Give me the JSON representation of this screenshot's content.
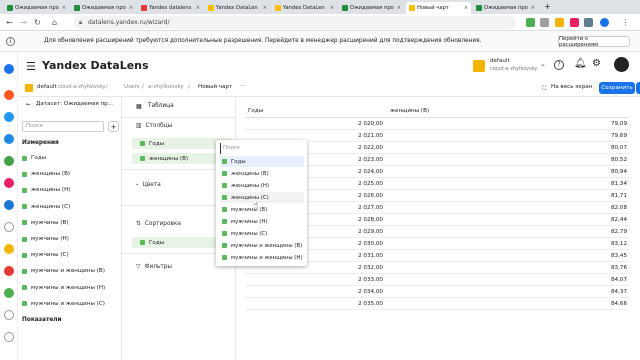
{
  "browser": {
    "tabs": [
      {
        "label": "Ожидаемая про",
        "color": "#1e8e3e"
      },
      {
        "label": "Ожидаемая про",
        "color": "#1e8e3e"
      },
      {
        "label": "Yandex datalens",
        "color": "#e53935"
      },
      {
        "label": "Yandex DataLen",
        "color": "#fbbc04"
      },
      {
        "label": "Yandex DataLen",
        "color": "#fbbc04"
      },
      {
        "label": "Ожидаемая про",
        "color": "#1e8e3e"
      },
      {
        "label": "Новый чарт",
        "color": "#fbbc04"
      },
      {
        "label": "Ожидаемая про",
        "color": "#1e8e3e"
      }
    ],
    "url": "datalens.yandex.ru/wizard/"
  },
  "notice": {
    "text": "Для обновления расширений требуются дополнительные разрешения. Перейдите в менеджер расширений для подтверждения обновления.",
    "button": "Перейти к расширениям"
  },
  "header": {
    "logo": "Yandex DataLens",
    "account_name": "default",
    "account_sub": "cloud-a-zhylkovsky"
  },
  "breadcrumbs": {
    "folder": "default",
    "folder_sub": "cloud-a-zhylkovsky",
    "path": [
      "Users",
      "a-zhylkovsky",
      "Новый чарт"
    ],
    "more": "···",
    "fullscreen": "На весь экран",
    "save": "Сохранить"
  },
  "left": {
    "dataset_label": "Датасет: Ожидаемая пр...",
    "search_placeholder": "Поиск",
    "add": "+",
    "dimensions_title": "Измерения",
    "dimensions": [
      "Годы",
      "женщины (В)",
      "женщины (Н)",
      "женщины (С)",
      "мужчины (В)",
      "мужчины (Н)",
      "мужчины (С)",
      "мужчины и женщины (В)",
      "мужчины и женщины (Н)",
      "мужчины и женщины (С)"
    ],
    "measures_title": "Показатели"
  },
  "mid": {
    "chart_type": "Таблица",
    "columns_title": "Столбцы",
    "columns": [
      "Годы",
      "женщины (В)"
    ],
    "colors_title": "Цвета",
    "sort_title": "Сортировка",
    "sort": [
      "Годы"
    ],
    "filters_title": "Фильтры"
  },
  "dropdown": {
    "placeholder": "Поиск",
    "items": [
      "Годы",
      "женщины (В)",
      "женщины (Н)",
      "женщины (С)",
      "мужчины (В)",
      "мужчины (Н)",
      "мужчины (С)",
      "мужчины и женщины (В)",
      "мужчины и женщины (Н)"
    ]
  },
  "table": {
    "headers": [
      "Годы",
      "женщины (В)"
    ],
    "rows": [
      [
        "2 020,00",
        "79,09"
      ],
      [
        "2 021,00",
        "79,69"
      ],
      [
        "2 022,00",
        "80,07"
      ],
      [
        "2 023,00",
        "80,52"
      ],
      [
        "2 024,00",
        "80,94"
      ],
      [
        "2 025,00",
        "81,34"
      ],
      [
        "2 026,00",
        "81,71"
      ],
      [
        "2 027,00",
        "82,08"
      ],
      [
        "2 028,00",
        "82,44"
      ],
      [
        "2 029,00",
        "82,79"
      ],
      [
        "2 030,00",
        "83,12"
      ],
      [
        "2 031,00",
        "83,45"
      ],
      [
        "2 032,00",
        "83,76"
      ],
      [
        "2 033,00",
        "84,07"
      ],
      [
        "2 034,00",
        "84,37"
      ],
      [
        "2 035,00",
        "84,66"
      ]
    ]
  }
}
